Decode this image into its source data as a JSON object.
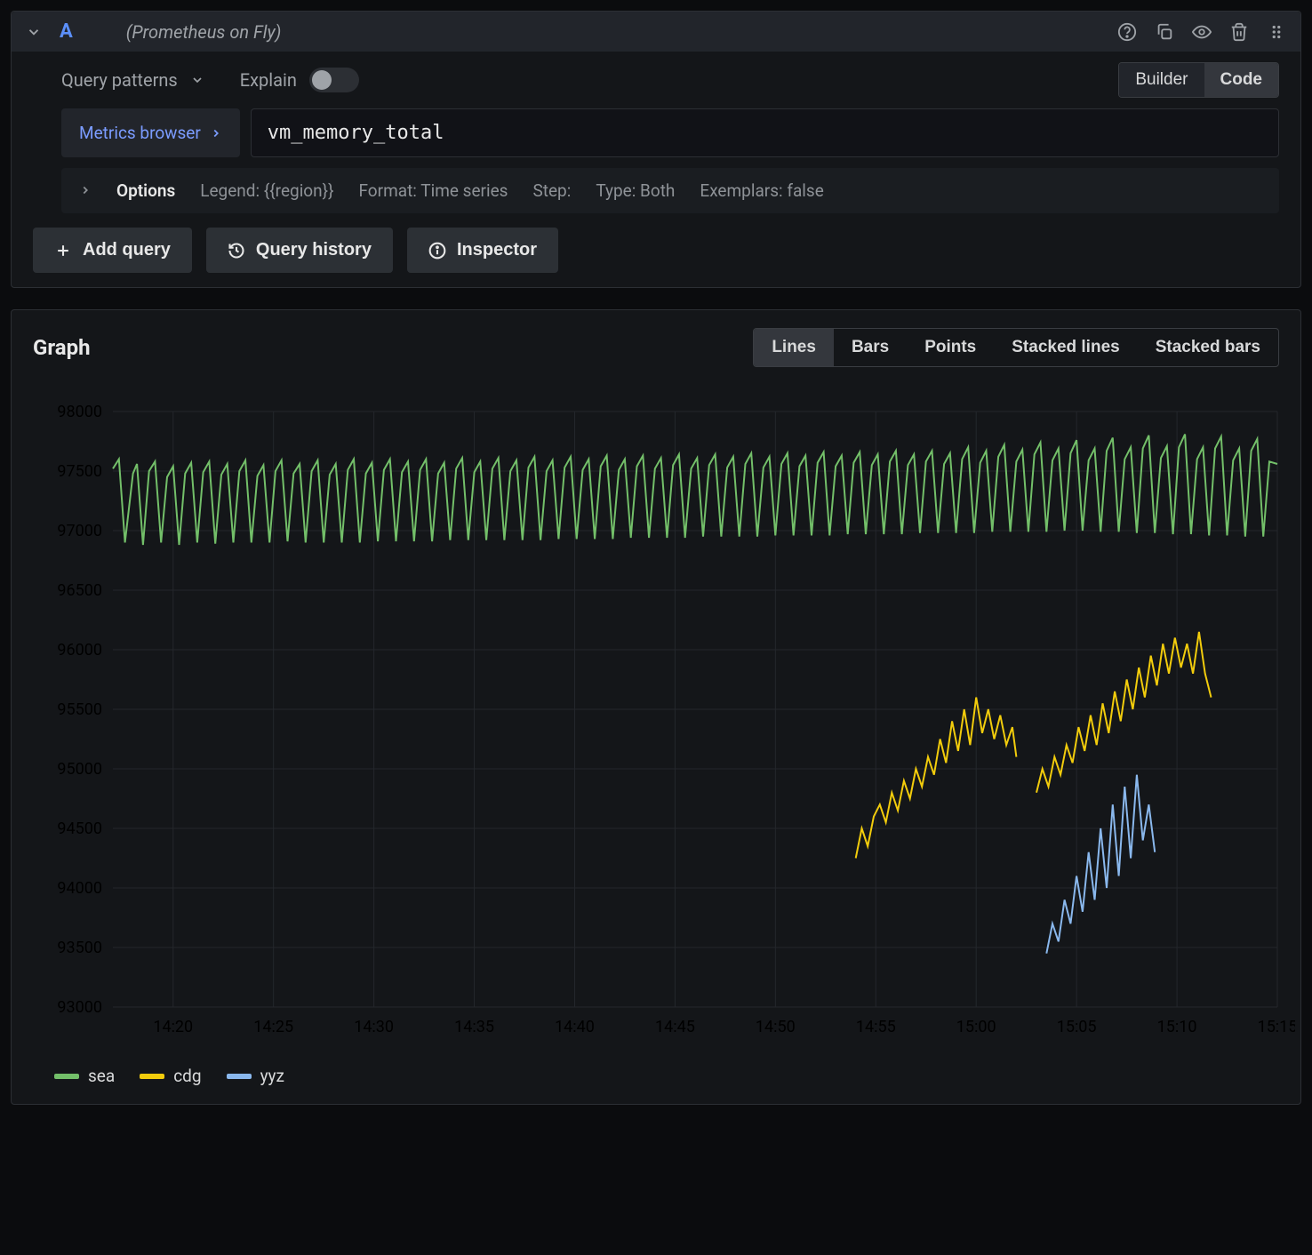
{
  "query": {
    "label": "A",
    "datasource": "(Prometheus on Fly)",
    "patterns_label": "Query patterns",
    "explain_label": "Explain",
    "mode": {
      "builder": "Builder",
      "code": "Code",
      "active": "code"
    },
    "metrics_browser": "Metrics browser",
    "expression": "vm_memory_total",
    "options": {
      "title": "Options",
      "legend": "Legend: {{region}}",
      "format": "Format: Time series",
      "step": "Step:",
      "type": "Type: Both",
      "exemplars": "Exemplars: false"
    },
    "actions": {
      "add_query": "Add query",
      "query_history": "Query history",
      "inspector": "Inspector"
    }
  },
  "graph": {
    "title": "Graph",
    "viz": {
      "lines": "Lines",
      "bars": "Bars",
      "points": "Points",
      "stacked_lines": "Stacked lines",
      "stacked_bars": "Stacked bars",
      "active": "lines"
    },
    "legend": [
      {
        "name": "sea",
        "color": "#73bf69"
      },
      {
        "name": "cdg",
        "color": "#f2cc0c"
      },
      {
        "name": "yyz",
        "color": "#8ab8ed"
      }
    ]
  },
  "chart_data": {
    "type": "line",
    "xlabel": "",
    "ylabel": "",
    "ylim": [
      93000,
      98000
    ],
    "x_ticks": [
      "14:20",
      "14:25",
      "14:30",
      "14:35",
      "14:40",
      "14:45",
      "14:50",
      "14:55",
      "15:00",
      "15:05",
      "15:10",
      "15:15"
    ],
    "y_ticks": [
      93000,
      93500,
      94000,
      94500,
      95000,
      95500,
      96000,
      96500,
      97000,
      97500,
      98000
    ],
    "x_range_minutes": [
      857,
      915
    ],
    "series": [
      {
        "name": "sea",
        "color": "#73bf69",
        "segments": [
          {
            "x": [
              857,
              857.3,
              857.6,
              858,
              858.2,
              858.5,
              858.8,
              859.1,
              859.4,
              859.7,
              860,
              860.3,
              860.6,
              860.9,
              861.2,
              861.5,
              861.8,
              862.1,
              862.4,
              862.7,
              863,
              863.3,
              863.6,
              863.9,
              864.2,
              864.5,
              864.8,
              865.1,
              865.4,
              865.7,
              866,
              866.3,
              866.6,
              866.9,
              867.2,
              867.5,
              867.8,
              868.1,
              868.4,
              868.7,
              869,
              869.3,
              869.6,
              869.9,
              870.2,
              870.5,
              870.8,
              871.1,
              871.4,
              871.7,
              872,
              872.3,
              872.6,
              872.9,
              873.2,
              873.5,
              873.8,
              874.1,
              874.4,
              874.7,
              875,
              875.3,
              875.6,
              875.9,
              876.2,
              876.5,
              876.8,
              877.1,
              877.4,
              877.7,
              878,
              878.3,
              878.6,
              878.9,
              879.2,
              879.5,
              879.8,
              880.1,
              880.4,
              880.7,
              881,
              881.3,
              881.6,
              881.9,
              882.2,
              882.5,
              882.8,
              883.1,
              883.4,
              883.7,
              884,
              884.3,
              884.6,
              884.9,
              885.2,
              885.5,
              885.8,
              886.1,
              886.4,
              886.7,
              887,
              887.3,
              887.6,
              887.9,
              888.2,
              888.5,
              888.8,
              889.1,
              889.4,
              889.7,
              890,
              890.3,
              890.6,
              890.9,
              891.2,
              891.5,
              891.8,
              892.1,
              892.4,
              892.7,
              893,
              893.3,
              893.6,
              893.9,
              894.2,
              894.5,
              894.8,
              895.1,
              895.4,
              895.7,
              896,
              896.3,
              896.6,
              896.9,
              897.2,
              897.5,
              897.8,
              898.1,
              898.4,
              898.7,
              899,
              899.3,
              899.6,
              899.9,
              900.2,
              900.5,
              900.8,
              901.1,
              901.4,
              901.7,
              902,
              902.3,
              902.6,
              902.9,
              903.2,
              903.5,
              903.8,
              904.1,
              904.4,
              904.7,
              905,
              905.3,
              905.6,
              905.9,
              906.2,
              906.5,
              906.8,
              907.1,
              907.4,
              907.7,
              908,
              908.3,
              908.6,
              908.9,
              909.2,
              909.5,
              909.8,
              910.1,
              910.4,
              910.7,
              911,
              911.3,
              911.6,
              911.9,
              912.2,
              912.5,
              912.8,
              913.1,
              913.4,
              913.7,
              914,
              914.3,
              914.6,
              915
            ],
            "y": [
              97520,
              97600,
              96900,
              97480,
              97560,
              96880,
              97500,
              97580,
              96900,
              97450,
              97540,
              96880,
              97480,
              97570,
              96900,
              97490,
              97580,
              96890,
              97470,
              97560,
              96900,
              97500,
              97590,
              96900,
              97460,
              97550,
              96900,
              97500,
              97590,
              96910,
              97480,
              97560,
              96900,
              97500,
              97590,
              96900,
              97470,
              97560,
              96900,
              97510,
              97600,
              96900,
              97480,
              97570,
              96910,
              97510,
              97600,
              96910,
              97490,
              97580,
              96910,
              97510,
              97600,
              96910,
              97480,
              97570,
              96920,
              97520,
              97610,
              96920,
              97490,
              97580,
              96920,
              97520,
              97610,
              96920,
              97500,
              97590,
              96920,
              97530,
              97620,
              96920,
              97500,
              97590,
              96930,
              97530,
              97620,
              96930,
              97510,
              97600,
              96930,
              97540,
              97630,
              96930,
              97510,
              97600,
              96940,
              97540,
              97630,
              96940,
              97520,
              97610,
              96940,
              97550,
              97640,
              96940,
              97520,
              97610,
              96950,
              97550,
              97640,
              96950,
              97530,
              97620,
              96950,
              97560,
              97650,
              96950,
              97530,
              97620,
              96960,
              97560,
              97650,
              96960,
              97540,
              97630,
              96960,
              97570,
              97660,
              96960,
              97540,
              97630,
              96970,
              97570,
              97660,
              96970,
              97550,
              97640,
              96970,
              97580,
              97670,
              96970,
              97550,
              97640,
              96980,
              97580,
              97670,
              96980,
              97560,
              97650,
              96980,
              97600,
              97700,
              96980,
              97570,
              97670,
              96990,
              97620,
              97720,
              96990,
              97580,
              97680,
              96990,
              97640,
              97740,
              96990,
              97590,
              97690,
              97000,
              97650,
              97760,
              97000,
              97590,
              97690,
              96990,
              97670,
              97780,
              96990,
              97600,
              97700,
              96980,
              97690,
              97800,
              96980,
              97610,
              97710,
              96970,
              97700,
              97810,
              96970,
              97600,
              97700,
              96960,
              97690,
              97790,
              96960,
              97590,
              97690,
              96950,
              97670,
              97770,
              96950,
              97580,
              97560
            ]
          }
        ]
      },
      {
        "name": "cdg",
        "color": "#f2cc0c",
        "segments": [
          {
            "x": [
              894,
              894.3,
              894.6,
              894.9,
              895.2,
              895.5,
              895.8,
              896.1,
              896.4,
              896.7,
              897,
              897.3,
              897.6,
              897.9,
              898.2,
              898.5,
              898.8,
              899.1,
              899.4,
              899.7,
              900,
              900.3,
              900.6,
              900.9,
              901.2,
              901.5,
              901.8,
              902
            ],
            "y": [
              94250,
              94500,
              94350,
              94600,
              94700,
              94550,
              94800,
              94650,
              94900,
              94750,
              95000,
              94850,
              95100,
              94950,
              95250,
              95050,
              95400,
              95150,
              95500,
              95200,
              95600,
              95300,
              95500,
              95250,
              95450,
              95200,
              95350,
              95100
            ]
          },
          {
            "x": [
              903,
              903.3,
              903.6,
              903.9,
              904.2,
              904.5,
              904.8,
              905.1,
              905.4,
              905.7,
              906,
              906.3,
              906.6,
              906.9,
              907.2,
              907.5,
              907.8,
              908.1,
              908.4,
              908.7,
              909,
              909.3,
              909.6,
              909.9,
              910.2,
              910.5,
              910.8,
              911.1,
              911.4,
              911.7
            ],
            "y": [
              94800,
              95000,
              94850,
              95100,
              94950,
              95200,
              95050,
              95350,
              95150,
              95450,
              95200,
              95550,
              95300,
              95650,
              95400,
              95750,
              95500,
              95850,
              95600,
              95950,
              95700,
              96050,
              95800,
              96100,
              95850,
              96050,
              95800,
              96150,
              95800,
              95600
            ]
          }
        ]
      },
      {
        "name": "yyz",
        "color": "#8ab8ed",
        "segments": [
          {
            "x": [
              903.5,
              903.8,
              904.1,
              904.4,
              904.7,
              905,
              905.3,
              905.6,
              905.9,
              906.2,
              906.5,
              906.8,
              907.1,
              907.4,
              907.7,
              908,
              908.3,
              908.6,
              908.9
            ],
            "y": [
              93450,
              93700,
              93550,
              93900,
              93700,
              94100,
              93800,
              94300,
              93900,
              94500,
              94000,
              94700,
              94100,
              94850,
              94250,
              94950,
              94400,
              94700,
              94300
            ]
          }
        ]
      }
    ]
  }
}
